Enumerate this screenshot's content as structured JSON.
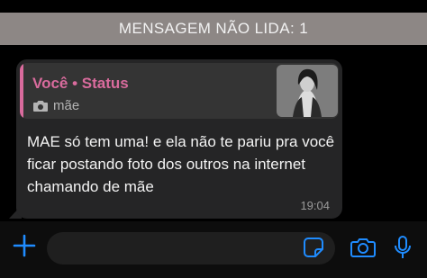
{
  "unread_banner": {
    "label": "MENSAGEM NÃO LIDA: 1"
  },
  "message": {
    "quote": {
      "author": "Você • Status",
      "caption": "mãe",
      "caption_icon": "camera-icon"
    },
    "text": "MAE só tem uma! e ela não te pariu pra você ficar postando foto dos outros na internet chamando de mãe",
    "time": "19:04"
  },
  "composer": {
    "placeholder": "",
    "icons": [
      "plus-icon",
      "sticker-icon",
      "camera-icon",
      "microphone-icon"
    ]
  },
  "colors": {
    "accent": "#1f8cff",
    "quote_accent": "#d96b9d",
    "bubble": "#252526",
    "banner": "#8d8785"
  }
}
